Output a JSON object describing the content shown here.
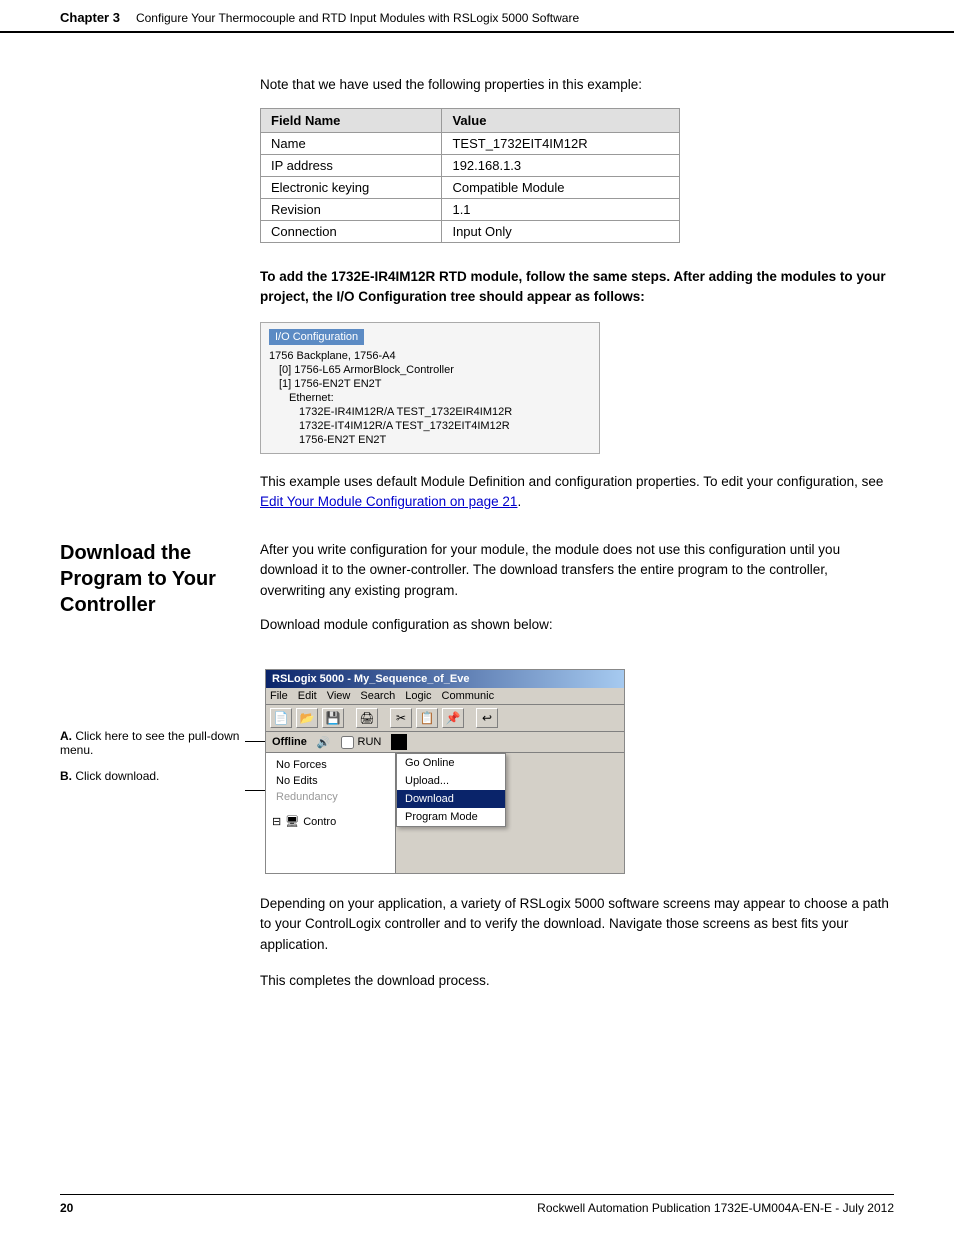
{
  "header": {
    "chapter": "Chapter 3",
    "title": "Configure Your Thermocouple and RTD Input Modules with RSLogix 5000 Software"
  },
  "intro": {
    "note_text": "Note that we have used the following properties in this example:"
  },
  "table": {
    "headers": [
      "Field Name",
      "Value"
    ],
    "rows": [
      [
        "Name",
        "TEST_1732EIT4IM12R"
      ],
      [
        "IP address",
        "192.168.1.3"
      ],
      [
        "Electronic keying",
        "Compatible Module"
      ],
      [
        "Revision",
        "1.1"
      ],
      [
        "Connection",
        "Input Only"
      ]
    ]
  },
  "rtd_text": "To add the 1732E-IR4IM12R RTD module, follow the same steps. After adding the modules to your project, the I/O Configuration tree should appear as follows:",
  "io_tree": {
    "title": "I/O Configuration",
    "items": [
      {
        "label": "1756 Backplane, 1756-A4",
        "indent": 1
      },
      {
        "label": "[0] 1756-L65 ArmorBlock_Controller",
        "indent": 2
      },
      {
        "label": "[1] 1756-EN2T EN2T",
        "indent": 2
      },
      {
        "label": "Ethernet:",
        "indent": 3
      },
      {
        "label": "1732E-IR4IM12R/A TEST_1732EIR4IM12R",
        "indent": 4
      },
      {
        "label": "1732E-IT4IM12R/A TEST_1732EIT4IM12R",
        "indent": 4
      },
      {
        "label": "1756-EN2T EN2T",
        "indent": 4
      }
    ]
  },
  "module_def_text": "This example uses default Module Definition and configuration properties. To edit your configuration, see ",
  "module_def_link": "Edit Your Module Configuration on page 21",
  "module_def_period": ".",
  "section_title": "Download the Program to\nYour Controller",
  "section_body1": "After you write configuration for your module, the module does not use this configuration until you download it to the owner-controller. The download transfers the entire program to the controller, overwriting any existing program.",
  "section_body2": "Download module configuration as shown below:",
  "software": {
    "titlebar": "RSLogix 5000 - My_Sequence_of_Eve",
    "menu": [
      "File",
      "Edit",
      "View",
      "Search",
      "Logic",
      "Communic"
    ],
    "offline_label": "Offline",
    "run_label": "RUN",
    "status_items": [
      "No Forces",
      "No Edits",
      "Redundancy"
    ],
    "dropdown_items": [
      {
        "label": "Go Online",
        "state": "normal"
      },
      {
        "label": "Upload...",
        "state": "normal"
      },
      {
        "label": "Download",
        "state": "highlighted"
      },
      {
        "label": "Program Mode",
        "state": "normal"
      }
    ],
    "controller_label": "Contro"
  },
  "annotations": {
    "a": {
      "letter": "A.",
      "text": "Click here to see the pull-down menu."
    },
    "b": {
      "letter": "B.",
      "text": "Click download."
    }
  },
  "body3": "Depending on your application, a variety of RSLogix 5000 software screens may appear to choose a path to your ControlLogix controller and to verify the download. Navigate those screens as best fits your application.",
  "body4": "This completes the download process.",
  "footer": {
    "page_number": "20",
    "publication": "Rockwell Automation Publication 1732E-UM004A-EN-E - July 2012"
  }
}
